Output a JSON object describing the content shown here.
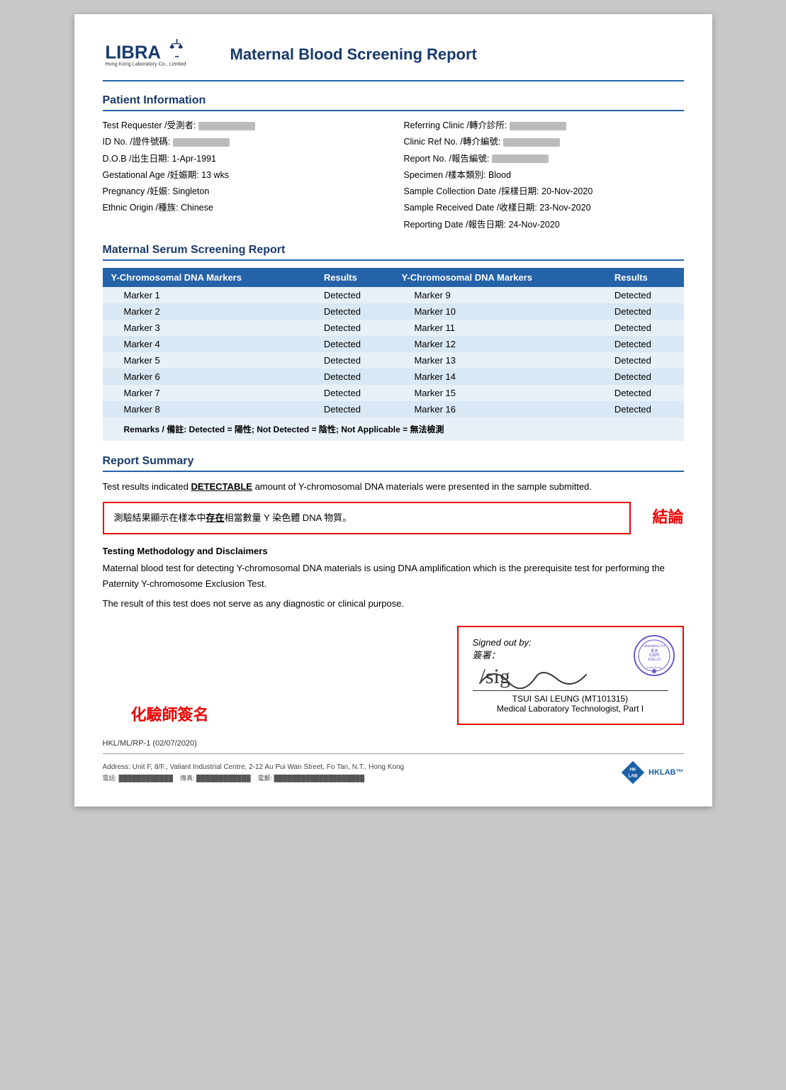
{
  "header": {
    "logo_text": "LIBRA",
    "logo_sub": "Hong Kong Laboratory Co., Limited",
    "report_title": "Maternal Blood Screening Report"
  },
  "patient_info": {
    "section_heading": "Patient Information",
    "fields_left": [
      {
        "label": "Test Requester /受測者:",
        "value": "REDACTED"
      },
      {
        "label": "ID No. /證件號碼:",
        "value": "REDACTED"
      },
      {
        "label": "D.O.B /出生日期:",
        "value": "1-Apr-1991"
      },
      {
        "label": "Gestational Age /妊娠期:",
        "value": "13 wks"
      },
      {
        "label": "Pregnancy /妊娠:",
        "value": "Singleton"
      },
      {
        "label": "Ethnic Origin /種族:",
        "value": "Chinese"
      }
    ],
    "fields_right": [
      {
        "label": "Referring Clinic /轉介診所:",
        "value": "REDACTED"
      },
      {
        "label": "Clinic Ref No. /轉介編號:",
        "value": "REDACTED"
      },
      {
        "label": "Report No. /報告編號:",
        "value": "REDACTED"
      },
      {
        "label": "Specimen /樣本類別:",
        "value": "Blood"
      },
      {
        "label": "Sample Collection Date /採樣日期:",
        "value": "20-Nov-2020"
      },
      {
        "label": "Sample Received Date /收樣日期:",
        "value": "23-Nov-2020"
      },
      {
        "label": "Reporting Date /報告日期:",
        "value": "24-Nov-2020"
      }
    ]
  },
  "serum_report": {
    "section_heading": "Maternal Serum Screening Report",
    "col1_header": "Y-Chromosomal DNA Markers",
    "col2_header": "Results",
    "col3_header": "Y-Chromosomal DNA Markers",
    "col4_header": "Results",
    "markers_left": [
      {
        "marker": "Marker 1",
        "result": "Detected"
      },
      {
        "marker": "Marker 2",
        "result": "Detected"
      },
      {
        "marker": "Marker 3",
        "result": "Detected"
      },
      {
        "marker": "Marker 4",
        "result": "Detected"
      },
      {
        "marker": "Marker 5",
        "result": "Detected"
      },
      {
        "marker": "Marker 6",
        "result": "Detected"
      },
      {
        "marker": "Marker 7",
        "result": "Detected"
      },
      {
        "marker": "Marker 8",
        "result": "Detected"
      }
    ],
    "markers_right": [
      {
        "marker": "Marker 9",
        "result": "Detected"
      },
      {
        "marker": "Marker 10",
        "result": "Detected"
      },
      {
        "marker": "Marker 11",
        "result": "Detected"
      },
      {
        "marker": "Marker 12",
        "result": "Detected"
      },
      {
        "marker": "Marker 13",
        "result": "Detected"
      },
      {
        "marker": "Marker 14",
        "result": "Detected"
      },
      {
        "marker": "Marker 15",
        "result": "Detected"
      },
      {
        "marker": "Marker 16",
        "result": "Detected"
      }
    ],
    "remarks": "Remarks / 備註: Detected = 陽性; Not Detected = 陰性; Not Applicable = 無法檢測"
  },
  "report_summary": {
    "section_heading": "Report Summary",
    "summary_line1": "Test results indicated ",
    "detectable_word": "DETECTABLE",
    "summary_line2": " amount of Y-chromosomal DNA materials were presented in the sample submitted.",
    "chinese_line1": "測驗結果顯示在樣本中",
    "chinese_underline": "存在",
    "chinese_line2": "相當數量 Y 染色體 DNA 物質。",
    "conclusion_label": "結論"
  },
  "methodology": {
    "heading": "Testing Methodology and Disclaimers",
    "text1": "Maternal blood test for detecting Y-chromosomal DNA materials is using DNA amplification which is the prerequisite test for performing the Paternity Y-chromosome Exclusion Test.",
    "text2": "The result of this test does not serve as any diagnostic or clinical purpose."
  },
  "signature": {
    "chemist_label": "化驗師簽名",
    "signed_out_label": "Signed out by:",
    "signed_out_chinese": "簽署：",
    "signer_name": "TSUI SAI LEUNG (MT101315)",
    "signer_title": "Medical Laboratory Technologist, Part I"
  },
  "footer": {
    "doc_ref": "HKL/ML/RP-1 (02/07/2020)",
    "address": "Address: Unit F, 8/F., Valiant Industrial Centre, 2-12 Au Pui Wan Street, Fo Tan, N.T., Hong Kong",
    "contacts": "電話: (phone redacted)   傳真: (fax redacted)   電郵: (email redacted)"
  }
}
